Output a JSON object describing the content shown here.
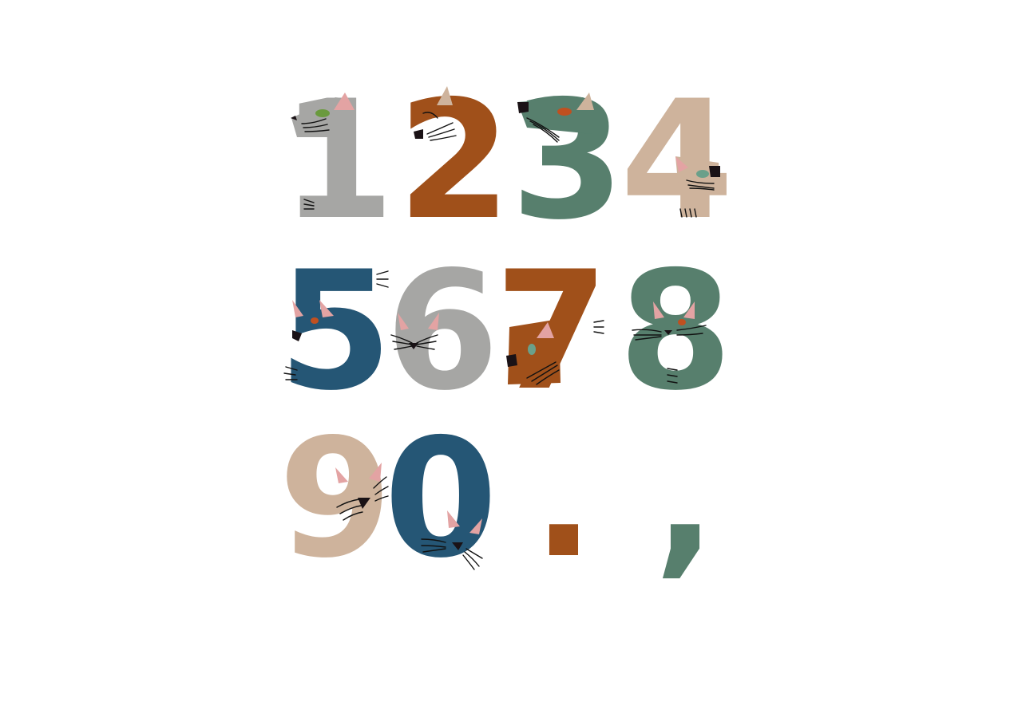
{
  "illustration": {
    "characters": [
      {
        "char": "1",
        "color": "#a6a6a4",
        "cat": "grey-cat-head-left"
      },
      {
        "char": "2",
        "color": "#a0501a",
        "cat": "orange-cat-head-left"
      },
      {
        "char": "3",
        "color": "#577f6d",
        "cat": "green-cat-head-left"
      },
      {
        "char": "4",
        "color": "#ceb39c",
        "cat": "beige-cat-head-right"
      },
      {
        "char": "5",
        "color": "#255675",
        "cat": "blue-cat-face"
      },
      {
        "char": "6",
        "color": "#a6a6a4",
        "cat": "grey-cat-face"
      },
      {
        "char": "7",
        "color": "#a0501a",
        "cat": "orange-cat-head-down"
      },
      {
        "char": "8",
        "color": "#577f6d",
        "cat": "green-cat-face"
      },
      {
        "char": "9",
        "color": "#ceb39c",
        "cat": "beige-cat-face"
      },
      {
        "char": "0",
        "color": "#255675",
        "cat": "blue-cat-face"
      },
      {
        "char": ".",
        "color": "#a0501a",
        "cat": ""
      },
      {
        "char": ",",
        "color": "#577f6d",
        "cat": ""
      }
    ],
    "colors": {
      "grey": "#a6a6a4",
      "orange": "#a0501a",
      "green": "#577f6d",
      "beige": "#ceb39c",
      "blue": "#255675",
      "ear_pink": "#e3a3a3",
      "nose": "#1a1216"
    }
  }
}
